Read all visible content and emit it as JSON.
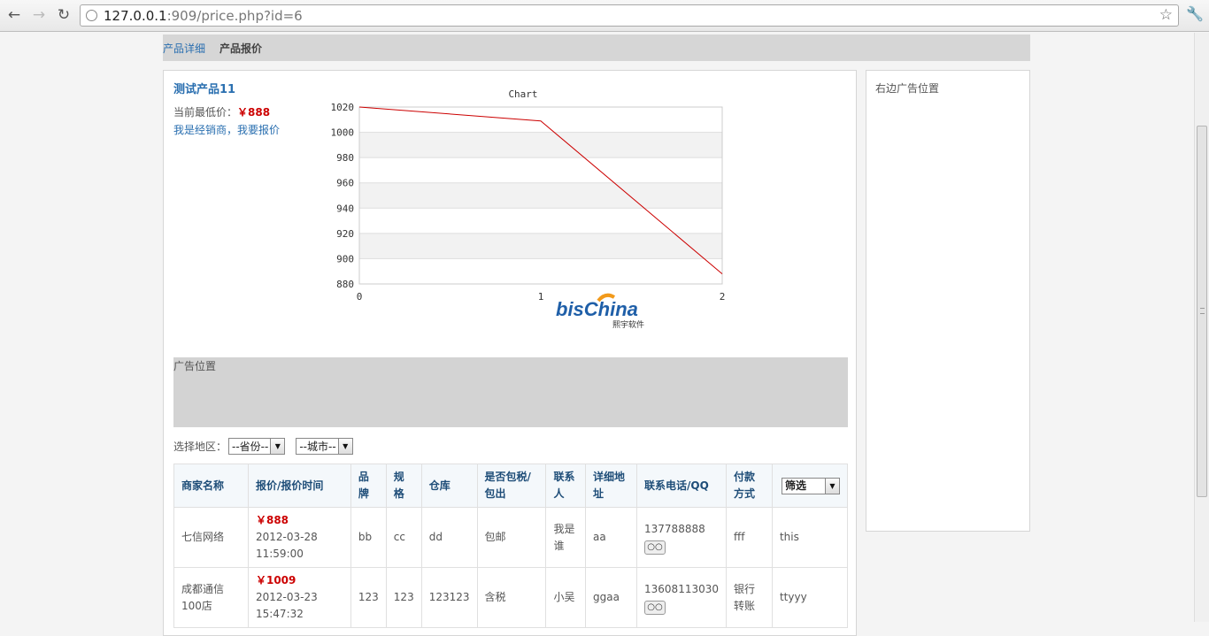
{
  "browser": {
    "url_host": "127.0.0.1",
    "url_rest": ":909/price.php?id=6"
  },
  "tabs": {
    "detail": "产品详细",
    "quote": "产品报价"
  },
  "product": {
    "title": "测试产品11",
    "low_price_label": "当前最低价：",
    "low_price_value": "￥888",
    "dealer_link": "我是经销商，我要报价"
  },
  "chart_data": {
    "type": "line",
    "title": "Chart",
    "x": [
      0,
      1,
      2
    ],
    "series": [
      {
        "values": [
          1020,
          1009,
          888
        ],
        "color": "#cc0000"
      }
    ],
    "xticks": [
      "0",
      "1",
      "2"
    ],
    "yticks": [
      "1020",
      "1000",
      "980",
      "960",
      "940",
      "920",
      "900",
      "880"
    ],
    "xlim": [
      0,
      2
    ],
    "ylim": [
      880,
      1020
    ],
    "grid": true
  },
  "logo": {
    "main": "bisChina",
    "sub": "熙宇软件"
  },
  "ad": {
    "label": "广告位置"
  },
  "side": {
    "label": "右边广告位置"
  },
  "region": {
    "label": "选择地区：",
    "province": "--省份--",
    "city": "--城市--"
  },
  "table": {
    "headers": [
      "商家名称",
      "报价/报价时间",
      "品牌",
      "规格",
      "仓库",
      "是否包税/包出",
      "联系人",
      "详细地址",
      "联系电话/QQ",
      "付款方式"
    ],
    "filter_label": "筛选",
    "rows": [
      {
        "merchant": "七信网络",
        "price": "￥888",
        "date": "2012-03-28",
        "time": "11:59:00",
        "brand": "bb",
        "spec": "cc",
        "warehouse": "dd",
        "tax": "包邮",
        "contact": "我是谁",
        "address": "aa",
        "phone": "137788888",
        "payment": "fff",
        "note": "this"
      },
      {
        "merchant": "成都通信100店",
        "price": "￥1009",
        "date": "2012-03-23",
        "time": "15:47:32",
        "brand": "123",
        "spec": "123",
        "warehouse": "123123",
        "tax": "含税",
        "contact": "小吴",
        "address": "ggaa",
        "phone": "13608113030",
        "payment": "银行转账",
        "note": "ttyyy"
      }
    ]
  },
  "colors": {
    "link": "#2a6fb0",
    "price": "#cc0000",
    "header_text": "#1e4d78",
    "ad_bg": "#d3d3d3"
  }
}
